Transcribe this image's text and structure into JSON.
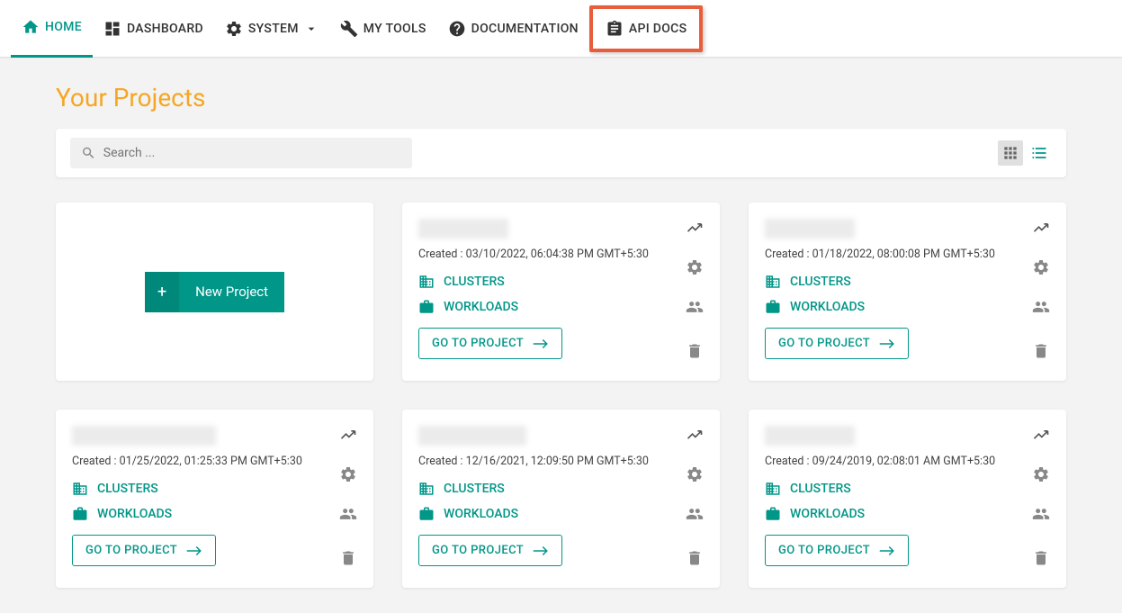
{
  "nav": {
    "items": [
      {
        "label": "HOME",
        "icon": "home",
        "active": true
      },
      {
        "label": "DASHBOARD",
        "icon": "dashboard"
      },
      {
        "label": "SYSTEM",
        "icon": "gear",
        "dropdown": true
      },
      {
        "label": "MY TOOLS",
        "icon": "wrench"
      },
      {
        "label": "DOCUMENTATION",
        "icon": "help"
      },
      {
        "label": "API DOCS",
        "icon": "clipboard",
        "highlighted": true
      }
    ]
  },
  "page": {
    "title": "Your Projects"
  },
  "search": {
    "placeholder": "Search ..."
  },
  "newProjectLabel": "New Project",
  "labels": {
    "clusters": "CLUSTERS",
    "workloads": "WORKLOADS",
    "goto": "GO TO PROJECT",
    "createdPrefix": "Created :  "
  },
  "projects": [
    {
      "created": "03/10/2022, 06:04:38 PM GMT+5:30",
      "nameWidth": "w1"
    },
    {
      "created": "01/18/2022, 08:00:08 PM GMT+5:30",
      "nameWidth": "w1"
    },
    {
      "created": "01/25/2022, 01:25:33 PM GMT+5:30",
      "nameWidth": "w2"
    },
    {
      "created": "12/16/2021, 12:09:50 PM GMT+5:30",
      "nameWidth": "w3"
    },
    {
      "created": "09/24/2019, 02:08:01 AM GMT+5:30",
      "nameWidth": "w1"
    }
  ]
}
